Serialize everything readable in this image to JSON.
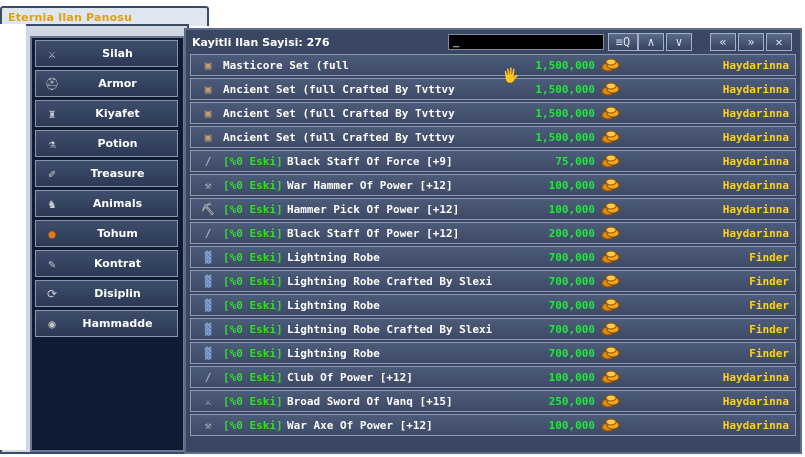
{
  "window": {
    "title": "Eternia Ilan Panosu"
  },
  "sidebar": {
    "items": [
      {
        "label": "Silah",
        "icon": "sword-icon"
      },
      {
        "label": "Armor",
        "icon": "helmet-icon"
      },
      {
        "label": "Kiyafet",
        "icon": "armor-icon"
      },
      {
        "label": "Potion",
        "icon": "potion-icon"
      },
      {
        "label": "Treasure",
        "icon": "scroll-icon"
      },
      {
        "label": "Animals",
        "icon": "animal-icon"
      },
      {
        "label": "Tohum",
        "icon": "pumpkin-icon"
      },
      {
        "label": "Kontrat",
        "icon": "contract-icon"
      },
      {
        "label": "Disiplin",
        "icon": "rope-icon"
      },
      {
        "label": "Hammadde",
        "icon": "gem-icon"
      }
    ]
  },
  "header": {
    "count_label": "Kayitli Ilan Sayisi: 276",
    "search_value": "_",
    "buttons": [
      {
        "name": "search-button",
        "glyph": "≡Q"
      },
      {
        "name": "scroll-up-button",
        "glyph": "∧"
      },
      {
        "name": "scroll-down-button",
        "glyph": "∨"
      },
      {
        "name": "first-page-button",
        "glyph": "«"
      },
      {
        "name": "last-page-button",
        "glyph": "»"
      },
      {
        "name": "close-button",
        "glyph": "✕"
      }
    ]
  },
  "listings": [
    {
      "eski": "",
      "name": "Masticore Set (full",
      "price": "1,500,000",
      "seller": "Haydarinna",
      "icon": "armor-set-icon"
    },
    {
      "eski": "",
      "name": "Ancient Set (full Crafted By Tvttvy",
      "price": "1,500,000",
      "seller": "Haydarinna",
      "icon": "armor-set-icon"
    },
    {
      "eski": "",
      "name": "Ancient Set (full Crafted By Tvttvy",
      "price": "1,500,000",
      "seller": "Haydarinna",
      "icon": "armor-set-icon"
    },
    {
      "eski": "",
      "name": "Ancient Set (full Crafted By Tvttvy",
      "price": "1,500,000",
      "seller": "Haydarinna",
      "icon": "armor-set-icon"
    },
    {
      "eski": "[%0 Eski]",
      "name": "Black Staff Of Force [+9]",
      "price": "75,000",
      "seller": "Haydarinna",
      "icon": "staff-icon"
    },
    {
      "eski": "[%0 Eski]",
      "name": "War Hammer Of Power [+12]",
      "price": "100,000",
      "seller": "Haydarinna",
      "icon": "hammer-icon"
    },
    {
      "eski": "[%0 Eski]",
      "name": "Hammer Pick Of Power [+12]",
      "price": "100,000",
      "seller": "Haydarinna",
      "icon": "pick-icon"
    },
    {
      "eski": "[%0 Eski]",
      "name": "Black Staff Of Power [+12]",
      "price": "200,000",
      "seller": "Haydarinna",
      "icon": "staff-icon"
    },
    {
      "eski": "[%0 Eski]",
      "name": "Lightning Robe",
      "price": "700,000",
      "seller": "Finder",
      "icon": "robe-icon"
    },
    {
      "eski": "[%0 Eski]",
      "name": "Lightning Robe Crafted By Slexi",
      "price": "700,000",
      "seller": "Finder",
      "icon": "robe-icon"
    },
    {
      "eski": "[%0 Eski]",
      "name": "Lightning Robe",
      "price": "700,000",
      "seller": "Finder",
      "icon": "robe-icon"
    },
    {
      "eski": "[%0 Eski]",
      "name": "Lightning Robe Crafted By Slexi",
      "price": "700,000",
      "seller": "Finder",
      "icon": "robe-icon"
    },
    {
      "eski": "[%0 Eski]",
      "name": "Lightning Robe",
      "price": "700,000",
      "seller": "Finder",
      "icon": "robe-icon"
    },
    {
      "eski": "[%0 Eski]",
      "name": "Club Of Power [+12]",
      "price": "100,000",
      "seller": "Haydarinna",
      "icon": "club-icon"
    },
    {
      "eski": "[%0 Eski]",
      "name": "Broad Sword Of Vanq [+15]",
      "price": "250,000",
      "seller": "Haydarinna",
      "icon": "sword-icon"
    },
    {
      "eski": "[%0 Eski]",
      "name": "War Axe Of Power [+12]",
      "price": "100,000",
      "seller": "Haydarinna",
      "icon": "axe-icon"
    }
  ],
  "colors": {
    "price": "#22e53a",
    "seller": "#ffd21a",
    "eski": "#2edb2e",
    "title": "#e0a010"
  }
}
